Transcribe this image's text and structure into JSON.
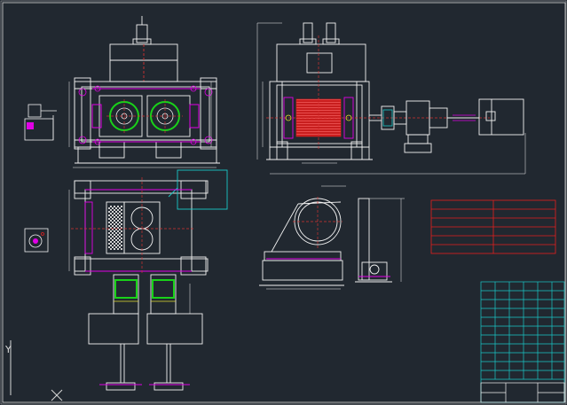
{
  "viewport": {
    "label": ""
  },
  "axis_icon": {
    "y_label": "Y"
  },
  "colors": {
    "background": "#212830",
    "frame": "#d8d8d8",
    "linework": "#f2f2f2",
    "accent_magenta": "#e100e6",
    "accent_green": "#19d219",
    "accent_red": "#e61e1e",
    "accent_cyan": "#19c8c8",
    "accent_yellow": "#e6dc32",
    "centerline": "#d23232"
  },
  "views": {
    "front": {
      "icon": "roller-press-front-view"
    },
    "side": {
      "icon": "roller-press-side-view"
    },
    "plan": {
      "icon": "roller-press-plan-view"
    },
    "hydraulic_unit": {
      "icon": "hydraulic-station-detail"
    },
    "motor_gauge": {
      "icon": "gauge-detail"
    },
    "bearing_detail": {
      "icon": "bearing-seat-detail"
    },
    "technical_table": {
      "icon": "technical-data-table",
      "rows": 6
    },
    "title_block": {
      "icon": "title-block-grid",
      "rows": 11,
      "cols": 6
    }
  }
}
